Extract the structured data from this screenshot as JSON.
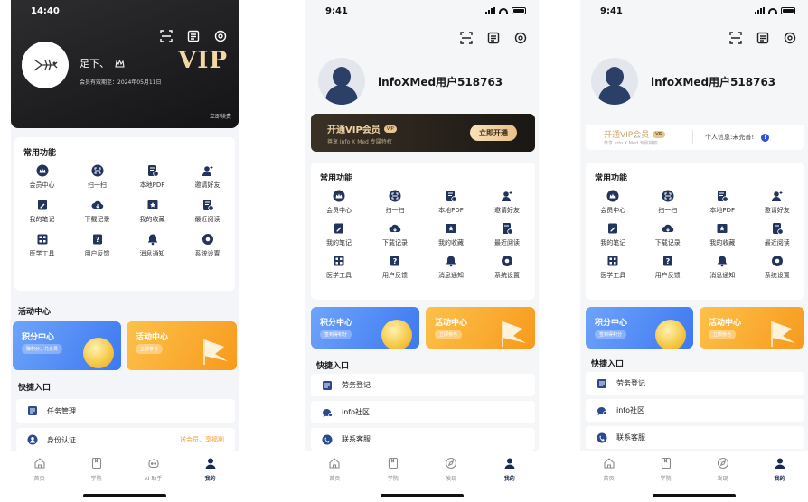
{
  "colors": {
    "brand_blue": "#3d78f0",
    "vip_gold": "#f1d3a3",
    "dark_bg": "#1a1714",
    "icon_navy": "#22335e",
    "orange": "#f79a1c"
  },
  "phone1": {
    "time": "14:40",
    "username": "足下、",
    "validity": "会员有效期至：2024年05月11日",
    "vip_mark": "VIP",
    "renew": "立即续费",
    "section_functions": "常用功能",
    "functions": [
      {
        "label": "会员中心",
        "icon": "crown-icon"
      },
      {
        "label": "扫一扫",
        "icon": "scan-icon"
      },
      {
        "label": "本地PDF",
        "icon": "pdf-icon"
      },
      {
        "label": "邀请好友",
        "icon": "invite-icon"
      },
      {
        "label": "我的笔记",
        "icon": "note-icon"
      },
      {
        "label": "下载记录",
        "icon": "download-icon"
      },
      {
        "label": "我的收藏",
        "icon": "star-icon"
      },
      {
        "label": "最近阅读",
        "icon": "recent-icon"
      },
      {
        "label": "医学工具",
        "icon": "tool-icon"
      },
      {
        "label": "用户反馈",
        "icon": "feedback-icon"
      },
      {
        "label": "消息通知",
        "icon": "bell-icon"
      },
      {
        "label": "系统设置",
        "icon": "settings-icon"
      }
    ],
    "section_activity": "活动中心",
    "points_title": "积分中心",
    "points_badge": "赚积分，兑会员",
    "activity_title": "活动中心",
    "activity_badge": "立即参与",
    "section_quick": "快捷入口",
    "quick": [
      {
        "label": "任务管理",
        "icon": "task-icon",
        "extra": ""
      },
      {
        "label": "身份认证",
        "icon": "id-icon",
        "extra": "送会员、享福利"
      }
    ],
    "tabs": [
      {
        "label": "首页",
        "icon": "home-icon",
        "active": false
      },
      {
        "label": "学院",
        "icon": "book-icon",
        "active": false
      },
      {
        "label": "AI 助手",
        "icon": "ai-icon",
        "active": false
      },
      {
        "label": "我的",
        "icon": "user-icon",
        "active": true
      }
    ]
  },
  "phone2": {
    "time": "9:41",
    "username": "infoXMed用户518763",
    "vip_title": "开通VIP会员",
    "vip_tag": "VIP",
    "vip_sub": "尊享 Info X Med 专属特权",
    "vip_button": "立即开通",
    "section_functions": "常用功能",
    "functions": [
      {
        "label": "会员中心",
        "icon": "crown-icon"
      },
      {
        "label": "扫一扫",
        "icon": "scan-icon"
      },
      {
        "label": "本地PDF",
        "icon": "pdf-icon"
      },
      {
        "label": "邀请好友",
        "icon": "invite-icon"
      },
      {
        "label": "我的笔记",
        "icon": "note-icon"
      },
      {
        "label": "下载记录",
        "icon": "download-icon"
      },
      {
        "label": "我的收藏",
        "icon": "star-icon"
      },
      {
        "label": "最近阅读",
        "icon": "recent-icon"
      },
      {
        "label": "医学工具",
        "icon": "tool-icon"
      },
      {
        "label": "用户反馈",
        "icon": "feedback-icon"
      },
      {
        "label": "消息通知",
        "icon": "bell-icon"
      },
      {
        "label": "系统设置",
        "icon": "settings-icon"
      }
    ],
    "points_title": "积分中心",
    "points_badge": "签到得积分",
    "activity_title": "活动中心",
    "activity_badge": "立即参与",
    "section_quick": "快捷入口",
    "quick": [
      {
        "label": "劳务登记",
        "icon": "register-icon"
      },
      {
        "label": "info社区",
        "icon": "community-icon"
      },
      {
        "label": "联系客服",
        "icon": "phone-icon"
      }
    ],
    "tabs": [
      {
        "label": "首页",
        "icon": "home-icon",
        "active": false
      },
      {
        "label": "学院",
        "icon": "book-icon",
        "active": false
      },
      {
        "label": "发现",
        "icon": "compass-icon",
        "active": false
      },
      {
        "label": "我的",
        "icon": "user-icon",
        "active": true
      }
    ]
  },
  "phone3": {
    "time": "9:41",
    "username": "infoXMed用户518763",
    "vip_title": "开通VIP会员",
    "vip_tag": "VIP",
    "vip_sub": "尊享 Info X Med 专属特权",
    "profile_status": "个人信息:未完善!",
    "warn_mark": "!",
    "section_functions": "常用功能",
    "functions": [
      {
        "label": "会员中心",
        "icon": "crown-icon"
      },
      {
        "label": "扫一扫",
        "icon": "scan-icon"
      },
      {
        "label": "本地PDF",
        "icon": "pdf-icon"
      },
      {
        "label": "邀请好友",
        "icon": "invite-icon"
      },
      {
        "label": "我的笔记",
        "icon": "note-icon"
      },
      {
        "label": "下载记录",
        "icon": "download-icon"
      },
      {
        "label": "我的收藏",
        "icon": "star-icon"
      },
      {
        "label": "最近阅读",
        "icon": "recent-icon"
      },
      {
        "label": "医学工具",
        "icon": "tool-icon"
      },
      {
        "label": "用户反馈",
        "icon": "feedback-icon"
      },
      {
        "label": "消息通知",
        "icon": "bell-icon"
      },
      {
        "label": "系统设置",
        "icon": "settings-icon"
      }
    ],
    "points_title": "积分中心",
    "points_badge": "签到得积分",
    "activity_title": "活动中心",
    "activity_badge": "立即参与",
    "section_quick": "快捷入口",
    "quick": [
      {
        "label": "劳务登记",
        "icon": "register-icon"
      },
      {
        "label": "info社区",
        "icon": "community-icon"
      },
      {
        "label": "联系客服",
        "icon": "phone-icon"
      }
    ],
    "tabs": [
      {
        "label": "首页",
        "icon": "home-icon",
        "active": false
      },
      {
        "label": "学院",
        "icon": "book-icon",
        "active": false
      },
      {
        "label": "发现",
        "icon": "compass-icon",
        "active": false
      },
      {
        "label": "我的",
        "icon": "user-icon",
        "active": true
      }
    ]
  }
}
